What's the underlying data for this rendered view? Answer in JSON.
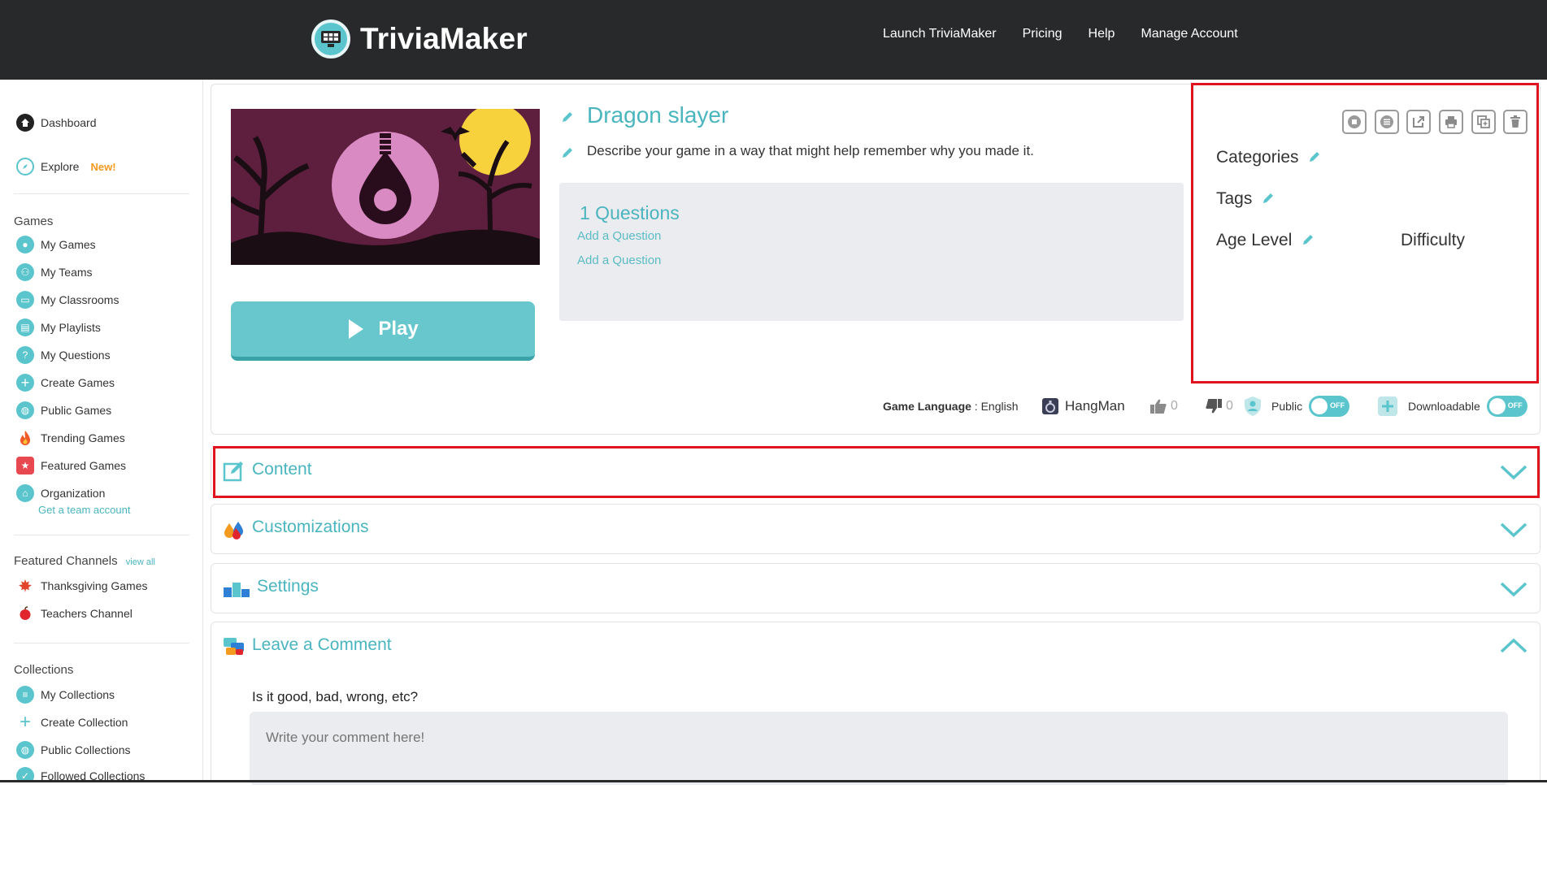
{
  "brand": {
    "name": "TriviaMaker"
  },
  "topnav": [
    "Launch TriviaMaker",
    "Pricing",
    "Help",
    "Manage Account"
  ],
  "sidebar": {
    "dashboard": "Dashboard",
    "explore": "Explore",
    "explore_badge": "New!",
    "games_heading": "Games",
    "games": [
      "My Games",
      "My Teams",
      "My Classrooms",
      "My Playlists",
      "My Questions",
      "Create Games",
      "Public Games",
      "Trending Games",
      "Featured Games",
      "Organization"
    ],
    "team_link": "Get a team account",
    "channels_heading": "Featured Channels",
    "channels_view_all": "view all",
    "channels": [
      "Thanksgiving Games",
      "Teachers Channel"
    ],
    "collections_heading": "Collections",
    "collections": [
      "My Collections",
      "Create Collection",
      "Public Collections",
      "Followed Collections"
    ]
  },
  "game": {
    "title": "Dragon slayer",
    "description": "Describe your game in a way that might help remember why you made it.",
    "play_label": "Play",
    "question_count": "1 Questions",
    "add_question_1": "Add a Question",
    "add_question_2": "Add a Question"
  },
  "meta": {
    "categories": "Categories",
    "tags": "Tags",
    "age_level": "Age Level",
    "difficulty": "Difficulty",
    "tools": [
      "circle-stop-icon",
      "list-icon",
      "external-link-icon",
      "print-icon",
      "copy-icon",
      "trash-icon"
    ]
  },
  "footer": {
    "language_label": "Game Language",
    "language_sep": " : ",
    "language_value": "English",
    "game_type": "HangMan",
    "likes": "0",
    "dislikes": "0",
    "public_label": "Public",
    "public_toggle": "OFF",
    "downloadable_label": "Downloadable",
    "downloadable_toggle": "OFF"
  },
  "sections": {
    "content": "Content",
    "customizations": "Customizations",
    "settings": "Settings",
    "comment": "Leave a Comment"
  },
  "comment": {
    "question": "Is it good, bad, wrong, etc?",
    "placeholder": "Write your comment here!"
  },
  "colors": {
    "accent": "#5ac5cc",
    "topbar": "#27292b",
    "highlight": "#e0141e",
    "new_badge": "#f39a1f"
  }
}
